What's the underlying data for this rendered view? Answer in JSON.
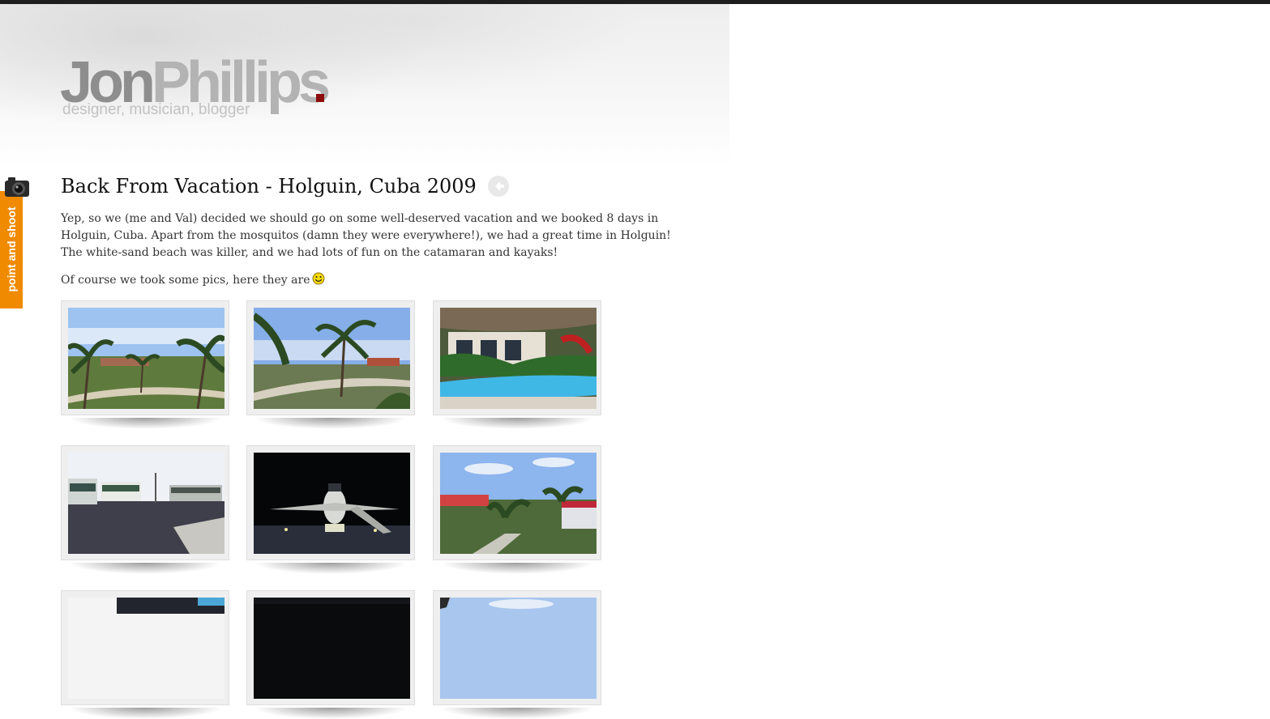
{
  "header": {
    "logo_first": "Jon",
    "logo_last": "Phillips",
    "tagline": "designer, musician, blogger",
    "colors": {
      "logo_dot": "#8b0d0d",
      "topbar": "#1e1e1e"
    }
  },
  "side_tab": {
    "label": "point and shoot",
    "icon": "camera-icon",
    "color": "#f08a00"
  },
  "post": {
    "title": "Back From Vacation - Holguin, Cuba 2009",
    "back_icon": "back-arrow-icon",
    "paragraph1": "Yep, so we (me and Val) decided we should go on some well-deserved vacation and we booked 8 days in Holguin, Cuba. Apart from the mosquitos (damn they were everywhere!), we had a great time in Holguin! The white-sand beach was killer, and we had lots of fun on the catamaran and kayaks!",
    "paragraph2": "Of course we took some pics, here they are",
    "emoticon": "smiley-icon"
  },
  "gallery": {
    "photos": [
      {
        "subject": "palm-trees-resort-lawn"
      },
      {
        "subject": "palm-trees-path"
      },
      {
        "subject": "pool-and-restaurant"
      },
      {
        "subject": "buses-parking-lot"
      },
      {
        "subject": "airplane-at-night"
      },
      {
        "subject": "resort-bungalows"
      },
      {
        "subject": "dark-building"
      },
      {
        "subject": "night-scene"
      },
      {
        "subject": "sky-scene"
      }
    ]
  }
}
